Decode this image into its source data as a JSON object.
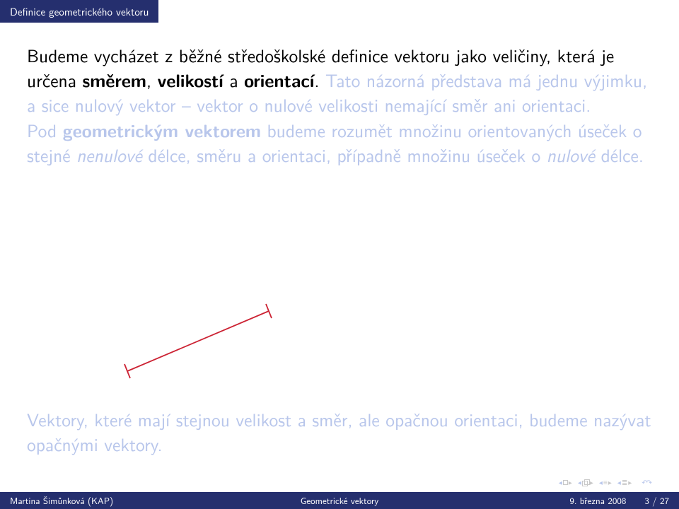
{
  "header": {
    "title": "Definice geometrického vektoru"
  },
  "body": {
    "p1_a": "Budeme vycházet z běžné středoškolské definice vektoru jako veličiny, která je určena ",
    "p1_b": "směrem",
    "p1_c": ", ",
    "p1_d": "velikostí",
    "p1_e": " a ",
    "p1_f": "orientací",
    "p1_g": ".",
    "p2_a": " Tato názorná představa má jednu výjimku, a sice nulový vektor – vektor o nulové velikosti nemající směr ani orientaci.",
    "p3_a": "Pod ",
    "p3_b": "geometrickým vektorem",
    "p3_c": " budeme rozumět množinu orientovaných úseček o stejné ",
    "p3_d": "nenulové",
    "p3_e": " délce, směru a orientaci, případně množinu úseček o ",
    "p3_f": "nulové",
    "p3_g": " délce.",
    "opposite": "Vektory, které mají stejnou velikost a směr, ale opačnou orientaci, budeme nazývat opačnými vektory."
  },
  "footer": {
    "left": "Martina Šimůnková (KAP)",
    "center": "Geometrické vektory",
    "right_date": "9. března 2008",
    "right_page": "3 / 27"
  }
}
